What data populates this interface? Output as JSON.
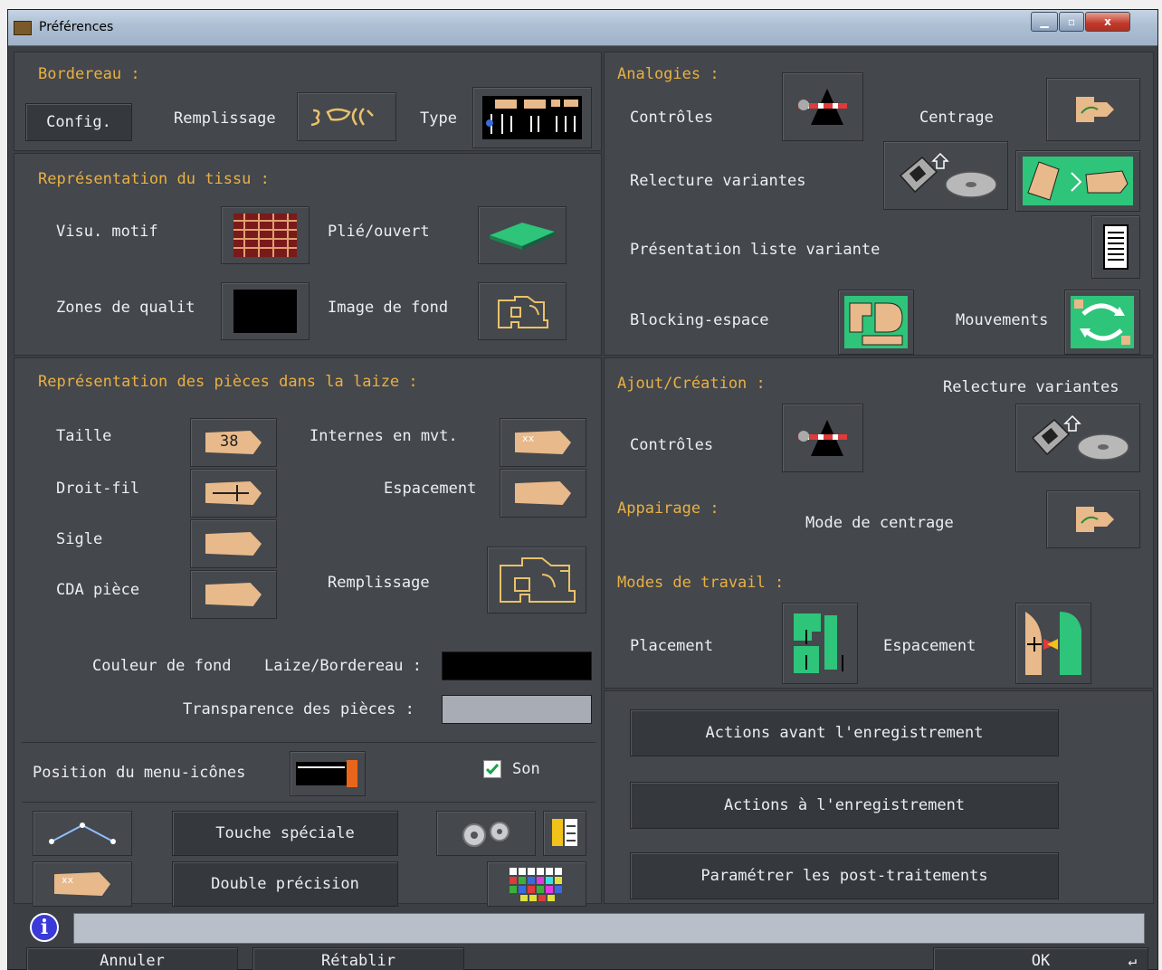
{
  "window": {
    "title": "Préférences",
    "close_glyph": "x"
  },
  "bordereau": {
    "header": "Bordereau :",
    "config": "Config.",
    "remplissage": "Remplissage",
    "type": "Type"
  },
  "tissu": {
    "header": "Représentation du tissu :",
    "visu_motif": "Visu. motif",
    "plie_ouvert": "Plié/ouvert",
    "zones_qualite": "Zones de qualit",
    "image_fond": "Image de fond"
  },
  "pieces": {
    "header": "Représentation des pièces dans la laize :",
    "taille": "Taille",
    "taille_value": "38",
    "internes": "Internes en mvt.",
    "droit_fil": "Droit-fil",
    "espacement": "Espacement",
    "sigle": "Sigle",
    "cda": "CDA pièce",
    "remplissage": "Remplissage",
    "couleur_fond": "Couleur de fond",
    "laize_bordereau": "Laize/Bordereau :",
    "transparence": "Transparence des pièces :",
    "position_menu": "Position du menu-icônes",
    "son": "Son",
    "touche_speciale": "Touche spéciale",
    "double_precision": "Double précision"
  },
  "analogies": {
    "header": "Analogies :",
    "controles": "Contrôles",
    "centrage": "Centrage",
    "relecture": "Relecture variantes",
    "presentation": "Présentation liste variante",
    "blocking": "Blocking-espace",
    "mouvements": "Mouvements"
  },
  "ajout": {
    "header": "Ajout/Création :",
    "relecture": "Relecture variantes",
    "controles": "Contrôles"
  },
  "appairage": {
    "header": "Appairage :",
    "mode_centrage": "Mode de centrage"
  },
  "modes": {
    "header": "Modes de travail :",
    "placement": "Placement",
    "espacement": "Espacement"
  },
  "actions": {
    "avant": "Actions avant l'enregistrement",
    "a": "Actions à l'enregistrement",
    "post": "Paramétrer les post-traitements"
  },
  "footer": {
    "annuler": "Annuler",
    "retablir": "Rétablir",
    "ok": "OK",
    "info_glyph": "i"
  },
  "colors": {
    "background_swatch": "#000000",
    "transparency_swatch": "#a8adb5",
    "accent_header": "#e9b043",
    "status_bar": "#b8bfc9"
  }
}
